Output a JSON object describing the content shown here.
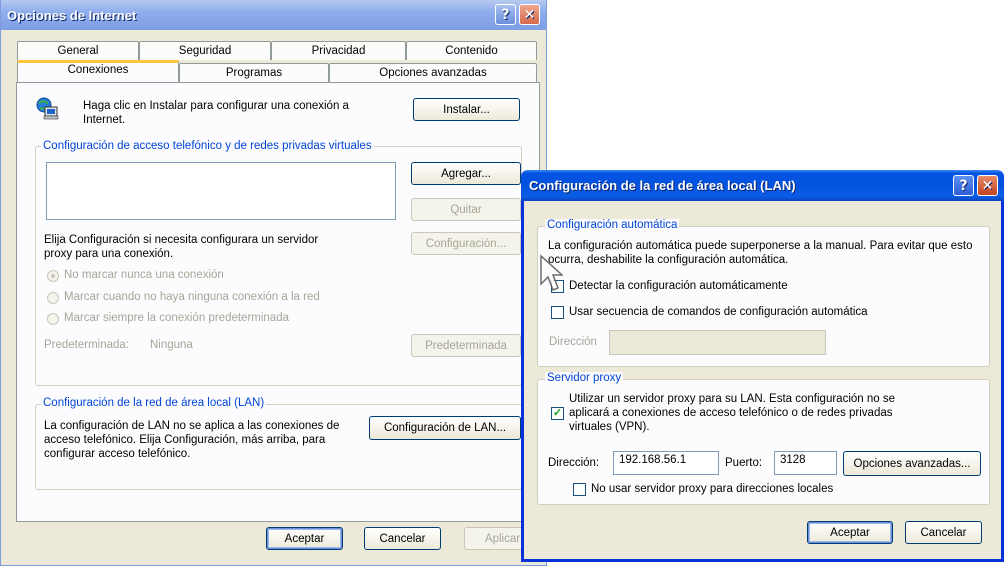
{
  "inet": {
    "title": "Opciones de Internet",
    "tabs_row1": [
      "General",
      "Seguridad",
      "Privacidad",
      "Contenido"
    ],
    "tabs_row2": [
      "Conexiones",
      "Programas",
      "Opciones avanzadas"
    ],
    "setup_text": "Haga clic en Instalar para configurar una conexión a Internet.",
    "setup_button": "Instalar...",
    "dialup_group": "Configuración de acceso telefónico y de redes privadas virtuales",
    "add_button": "Agregar...",
    "remove_button": "Quitar",
    "settings_button": "Configuración...",
    "proxy_hint": "Elija Configuración si necesita configurara un servidor proxy para una conexión.",
    "radio_never": "No marcar nunca una conexión",
    "radio_when_no_network": "Marcar cuando no haya ninguna conexión a la red",
    "radio_always": "Marcar siempre la conexión predeterminada",
    "default_label": "Predeterminada:",
    "default_value": "Ninguna",
    "default_button": "Predeterminada",
    "lan_group": "Configuración de la red de área local (LAN)",
    "lan_text": "La configuración de LAN no se aplica a las conexiones de acceso telefónico. Elija Configuración, más arriba, para configurar acceso telefónico.",
    "lan_button": "Configuración de LAN...",
    "ok": "Aceptar",
    "cancel": "Cancelar",
    "apply": "Aplicar"
  },
  "lan": {
    "title": "Configuración de la red de área local (LAN)",
    "auto_group": "Configuración automática",
    "auto_text": "La configuración automática puede superponerse a la manual. Para evitar que esto ocurra, deshabilite la configuración automática.",
    "detect_label": "Detectar la configuración automáticamente",
    "detect_checked": false,
    "script_label": "Usar secuencia de comandos de configuración automática",
    "script_checked": false,
    "address_label": "Dirección",
    "proxy_group": "Servidor proxy",
    "use_proxy_label": "Utilizar un servidor proxy para su LAN. Esta configuración no se aplicará a conexiones de acceso telefónico o de redes privadas virtuales (VPN).",
    "use_proxy_checked": true,
    "proxy_address_label": "Dirección:",
    "proxy_address": "192.168.56.1",
    "port_label": "Puerto:",
    "port": "3128",
    "advanced_button": "Opciones avanzadas...",
    "bypass_label": "No usar servidor proxy para direcciones locales",
    "bypass_checked": false,
    "ok": "Aceptar",
    "cancel": "Cancelar"
  },
  "icons": {
    "help": "?",
    "close": "✕",
    "check": "✓"
  }
}
